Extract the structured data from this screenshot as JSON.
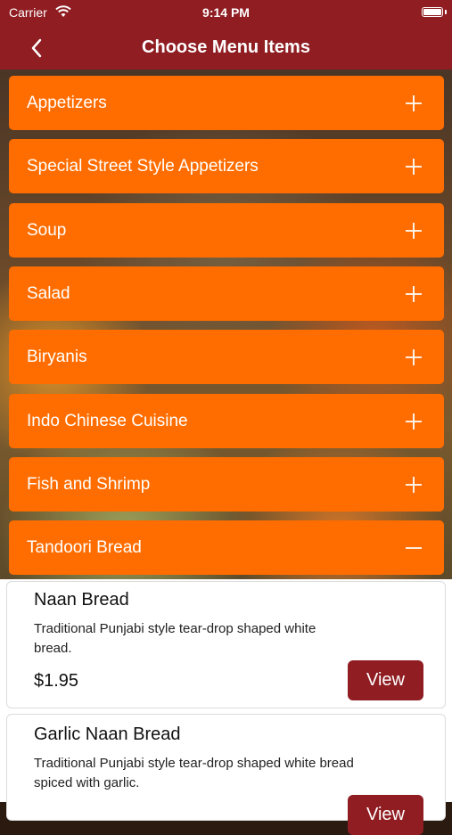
{
  "status_bar": {
    "carrier": "Carrier",
    "time": "9:14 PM"
  },
  "nav": {
    "title": "Choose Menu Items",
    "back_icon": "chevron-left-icon"
  },
  "categories": [
    {
      "label": "Appetizers",
      "icon": "plus-icon",
      "expanded": false
    },
    {
      "label": "Special Street Style Appetizers",
      "icon": "plus-icon",
      "expanded": false
    },
    {
      "label": "Soup",
      "icon": "plus-icon",
      "expanded": false
    },
    {
      "label": "Salad",
      "icon": "plus-icon",
      "expanded": false
    },
    {
      "label": "Biryanis",
      "icon": "plus-icon",
      "expanded": false
    },
    {
      "label": "Indo Chinese Cuisine",
      "icon": "plus-icon",
      "expanded": false
    },
    {
      "label": "Fish and Shrimp",
      "icon": "plus-icon",
      "expanded": false
    },
    {
      "label": "Tandoori Bread",
      "icon": "minus-icon",
      "expanded": true
    }
  ],
  "items": [
    {
      "name": "Naan Bread",
      "description": "Traditional Punjabi style tear-drop shaped white bread.",
      "price": "$1.95",
      "button": "View"
    },
    {
      "name": "Garlic Naan Bread",
      "description": "Traditional Punjabi style tear-drop shaped white bread spiced with garlic.",
      "price": "",
      "button": "View"
    }
  ],
  "colors": {
    "header": "#8f1d22",
    "category": "#ff6d00",
    "button": "#8f1d22"
  }
}
